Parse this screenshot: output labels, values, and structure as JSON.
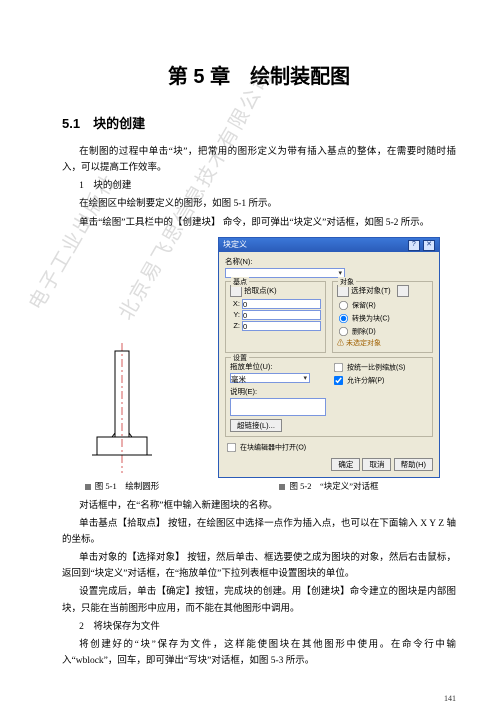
{
  "watermark1": "电子工业出版社",
  "watermark2": "北京易飞思信息技术有限公司",
  "chapter_title": "第 5 章　绘制装配图",
  "section_title": "5.1　块的创建",
  "para1": "在制图的过程中单击“块”，把常用的图形定义为带有插入基点的整体，在需要时随时插入，可以提高工作效率。",
  "sub1_title": "1　块的创建",
  "sub1_p1": "在绘图区中绘制要定义的图形，如图 5-1 所示。",
  "sub1_p2": "单击“绘图”工具栏中的【创建块】 命令，即可弹出“块定义”对话框，如图 5-2 所示。",
  "fig1_caption": "图 5-1　绘制圆形",
  "fig2_caption": "图 5-2　“块定义”对话框",
  "para_after_fig_1": "对话框中，在“名称”框中输入新建图块的名称。",
  "para_after_fig_2": "单击基点【拾取点】 按钮，在绘图区中选择一点作为插入点，也可以在下面输入 X Y Z 轴的坐标。",
  "para_after_fig_3": "单击对象的【选择对象】 按钮，然后单击、框选要使之成为图块的对象，然后右击鼠标，返回到“块定义”对话框，在“拖放单位”下拉列表框中设置图块的单位。",
  "para_after_fig_4": "设置完成后，单击【确定】按钮，完成块的创建。用【创建块】命令建立的图块是内部图块，只能在当前图形中应用，而不能在其他图形中调用。",
  "sub2_title": "2　将块保存为文件",
  "sub2_p1": "将创建好的“块”保存为文件，这样能使图块在其他图形中使用。在命令行中输入“wblock”，回车，即可弹出“写块”对话框，如图 5-3 所示。",
  "dialog": {
    "title": "块定义",
    "help_icon": "?",
    "close_icon": "✕",
    "name_label": "名称(N):",
    "name_value": "",
    "base_group": "基点",
    "pick_point": "拾取点(K)",
    "x_label": "X:",
    "x_val": "0",
    "y_label": "Y:",
    "y_val": "0",
    "z_label": "Z:",
    "z_val": "0",
    "obj_group": "对象",
    "select_obj": "选择对象(T)",
    "opt_retain": "保留(R)",
    "opt_convert": "转换为块(C)",
    "opt_delete": "删除(D)",
    "warn_noobj": "未选定对象",
    "settings_group": "设置",
    "unit_label": "拖放单位(U):",
    "unit_value": "毫米",
    "desc_label": "说明(E):",
    "scale_uniform": "按统一比例缩放(S)",
    "allow_explode": "允许分解(P)",
    "open_editor": "在块编辑器中打开(O)",
    "hyperlink": "超链接(L)...",
    "ok": "确定",
    "cancel": "取消",
    "help": "帮助(H)"
  },
  "page_number": "141"
}
